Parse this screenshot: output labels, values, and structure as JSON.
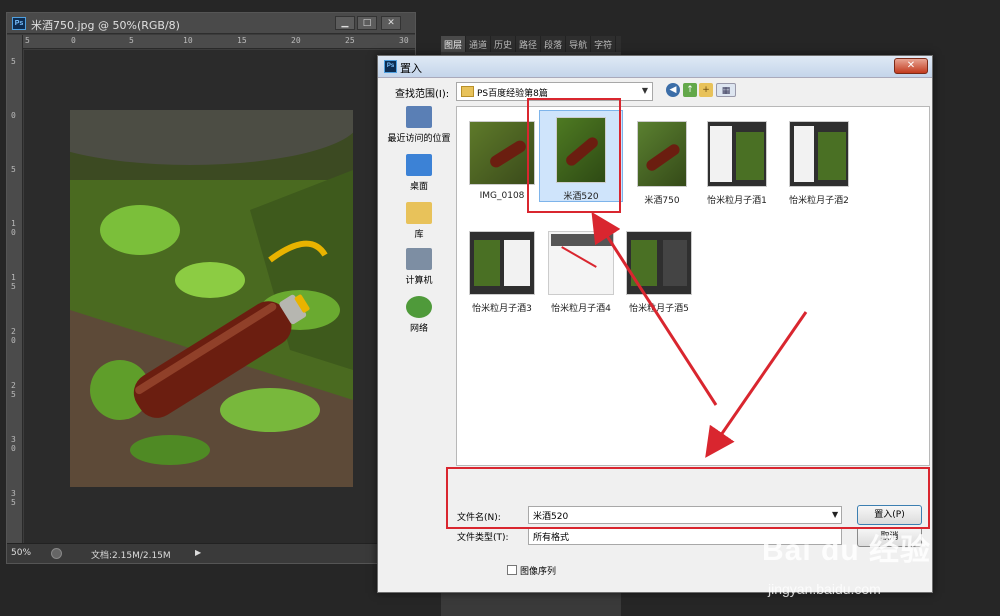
{
  "document": {
    "title": "米酒750.jpg @ 50%(RGB/8)",
    "ruler_top": [
      "5",
      "0",
      "5",
      "10",
      "15",
      "20",
      "25",
      "30"
    ],
    "ruler_left": [
      "5",
      "0",
      "5",
      "1\n0",
      "1\n5",
      "2\n0",
      "2\n5",
      "3\n0",
      "3\n5"
    ],
    "status": {
      "zoom": "50%",
      "info": "文档:2.15M/2.15M"
    },
    "window_buttons": [
      "▁",
      "□",
      "✕"
    ]
  },
  "panel": {
    "tabs": [
      "图层",
      "通道",
      "历史",
      "路径",
      "段落",
      "导航",
      "字符"
    ]
  },
  "dialog": {
    "title": "置入",
    "close_label": "✕",
    "look_in_label": "查找范围(I):",
    "look_in_value": "PS百度经验第8篇",
    "places": [
      {
        "label": "最近访问的位置",
        "icon": "recent-places-icon",
        "color": "#5a7fb5"
      },
      {
        "label": "桌面",
        "icon": "desktop-icon",
        "color": "#3c82d6"
      },
      {
        "label": "库",
        "icon": "library-icon",
        "color": "#e8c25a"
      },
      {
        "label": "计算机",
        "icon": "computer-icon",
        "color": "#7d8ea3"
      },
      {
        "label": "网络",
        "icon": "network-icon",
        "color": "#4f9a3a"
      }
    ],
    "files": [
      {
        "name": "IMG_0108",
        "kind": "photo"
      },
      {
        "name": "米酒520",
        "kind": "photo",
        "selected": true
      },
      {
        "name": "米酒750",
        "kind": "photo"
      },
      {
        "name": "怡米粒月子酒1",
        "kind": "screenshot"
      },
      {
        "name": "怡米粒月子酒2",
        "kind": "screenshot"
      },
      {
        "name": "怡米粒月子酒3",
        "kind": "screenshot"
      },
      {
        "name": "怡米粒月子酒4",
        "kind": "screenshot"
      },
      {
        "name": "怡米粒月子酒5",
        "kind": "screenshot"
      }
    ],
    "filename_label": "文件名(N):",
    "filename_value": "米酒520",
    "filetype_label": "文件类型(T):",
    "filetype_value": "所有格式",
    "place_button": "置入(P)",
    "cancel_button": "取消",
    "image_sequence_label": "图像序列"
  },
  "watermark": {
    "main": "Bai du 经验",
    "sub": "jingyan.baidu.com"
  },
  "colors": {
    "annotation_red": "#d9262f",
    "selection_blue": "#cfe4fb"
  }
}
